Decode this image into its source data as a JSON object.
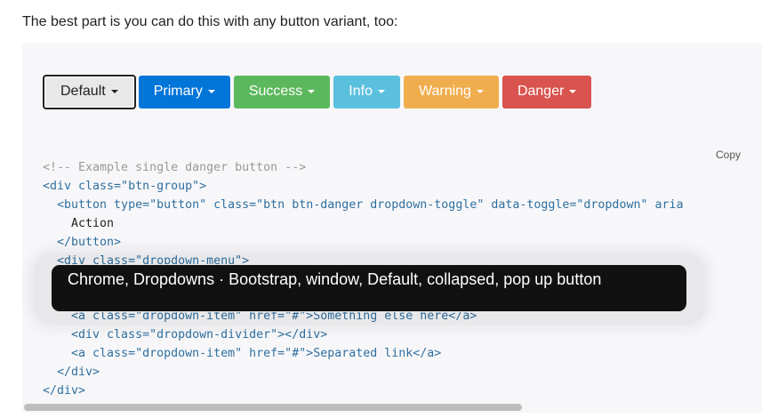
{
  "intro": "The best part is you can do this with any button variant, too:",
  "buttons": [
    {
      "label": "Default",
      "color": "#e8e8e8"
    },
    {
      "label": "Primary",
      "color": "#0275d8"
    },
    {
      "label": "Success",
      "color": "#5cb85c"
    },
    {
      "label": "Info",
      "color": "#5bc0de"
    },
    {
      "label": "Warning",
      "color": "#f0ad4e"
    },
    {
      "label": "Danger",
      "color": "#d9534f"
    }
  ],
  "code": {
    "copy_label": "Copy",
    "lines": [
      "<!-- Example single danger button -->",
      "<div class=\"btn-group\">",
      "  <button type=\"button\" class=\"btn btn-danger dropdown-toggle\" data-toggle=\"dropdown\" aria",
      "    Action",
      "  </button>",
      "  <div class=\"dropdown-menu\">",
      "",
      "",
      "    <a class=\"dropdown-item\" href=\"#\">Something else here</a>",
      "    <div class=\"dropdown-divider\"></div>",
      "    <a class=\"dropdown-item\" href=\"#\">Separated link</a>",
      "  </div>",
      "</div>"
    ]
  },
  "tooltip": "Chrome, Dropdowns · Bootstrap, window, Default, collapsed, pop up button"
}
